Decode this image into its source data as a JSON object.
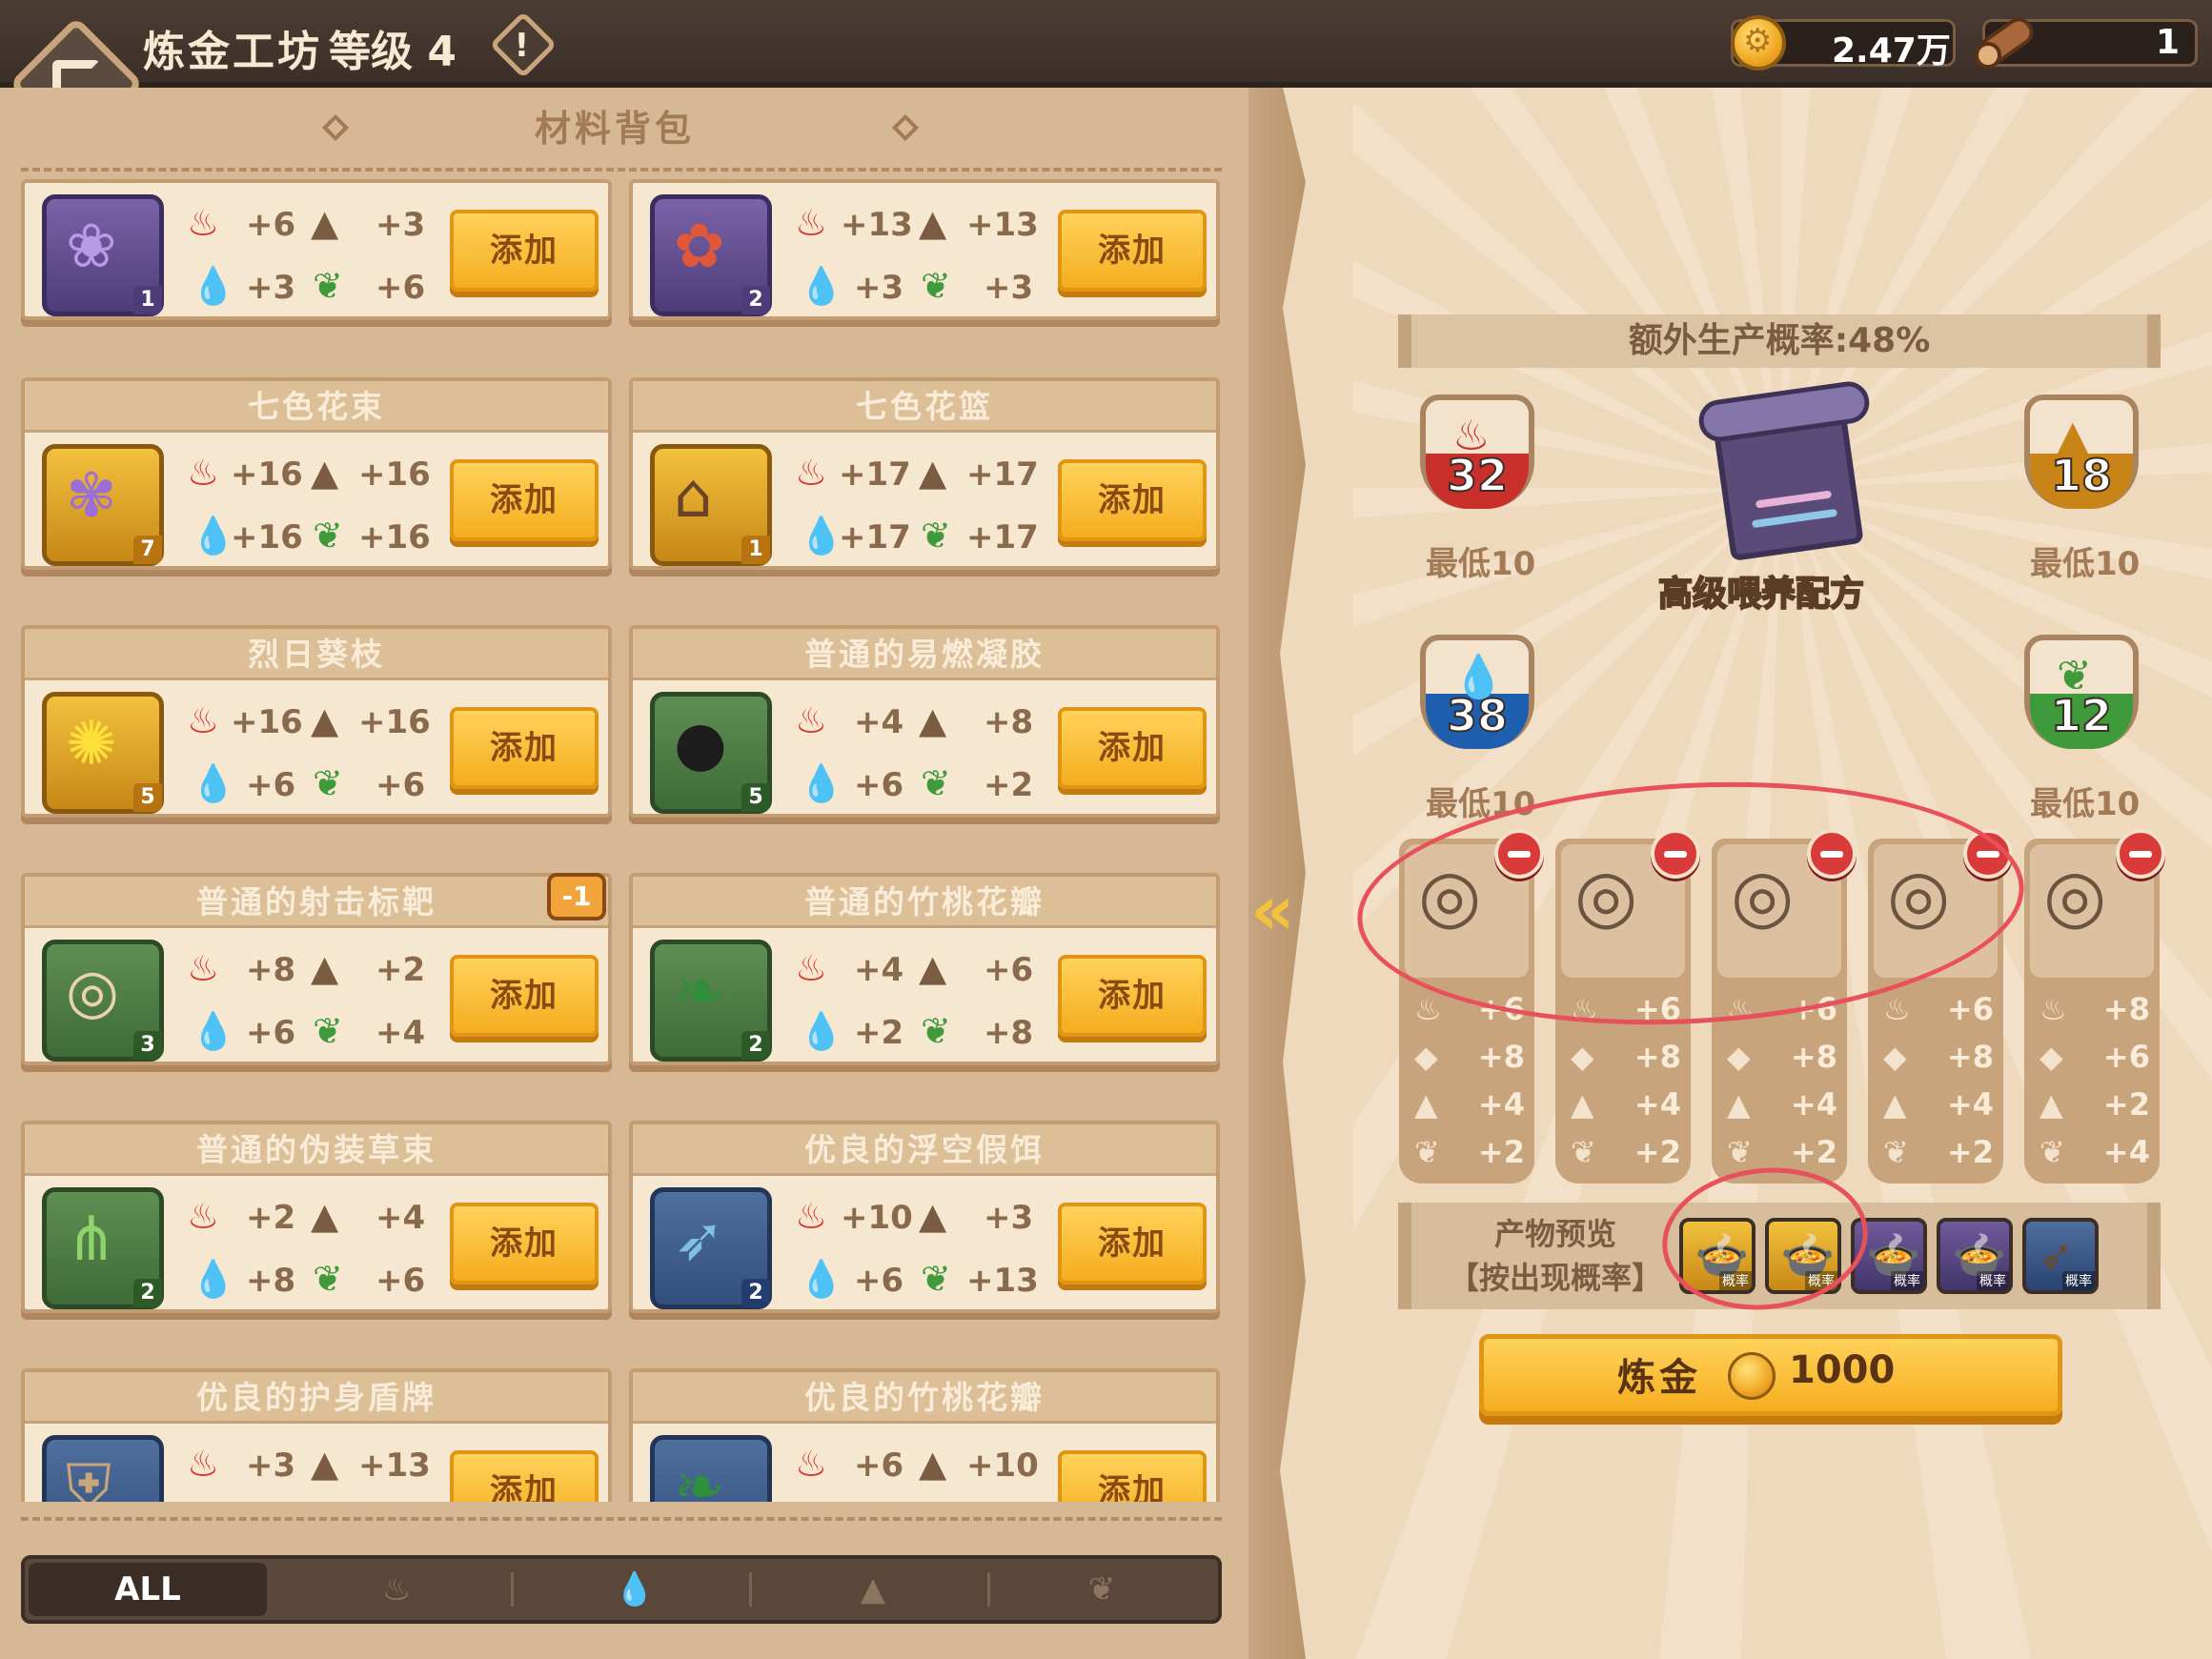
{
  "header": {
    "title": "炼金工坊",
    "level_text": "等级 4",
    "warning": "!",
    "coins": "2.47万",
    "wood": "1"
  },
  "bag": {
    "title": "材料背包",
    "add_label": "添加",
    "items": [
      {
        "name": "",
        "qty": "1",
        "fire": "+6",
        "earth": "+3",
        "water": "+3",
        "leaf": "+6",
        "icon": "violet-wreath-icon"
      },
      {
        "name": "",
        "qty": "2",
        "fire": "+13",
        "earth": "+13",
        "water": "+3",
        "leaf": "+3",
        "icon": "red-flower-icon"
      },
      {
        "name": "七色花束",
        "qty": "7",
        "fire": "+16",
        "earth": "+16",
        "water": "+16",
        "leaf": "+16",
        "icon": "bouquet-icon"
      },
      {
        "name": "七色花篮",
        "qty": "1",
        "fire": "+17",
        "earth": "+17",
        "water": "+17",
        "leaf": "+17",
        "icon": "flower-basket-icon"
      },
      {
        "name": "烈日葵枝",
        "qty": "5",
        "fire": "+16",
        "earth": "+16",
        "water": "+6",
        "leaf": "+6",
        "icon": "sunflower-icon"
      },
      {
        "name": "普通的易燃凝胶",
        "qty": "5",
        "fire": "+4",
        "earth": "+8",
        "water": "+6",
        "leaf": "+2",
        "icon": "gel-icon"
      },
      {
        "name": "普通的射击标靶",
        "qty": "3",
        "fire": "+8",
        "earth": "+2",
        "water": "+6",
        "leaf": "+4",
        "icon": "target-icon",
        "minus": "-1"
      },
      {
        "name": "普通的竹桃花瓣",
        "qty": "2",
        "fire": "+4",
        "earth": "+6",
        "water": "+2",
        "leaf": "+8",
        "icon": "leaf-petal-icon"
      },
      {
        "name": "普通的伪装草束",
        "qty": "2",
        "fire": "+2",
        "earth": "+4",
        "water": "+8",
        "leaf": "+6",
        "icon": "grass-bundle-icon"
      },
      {
        "name": "优良的浮空假饵",
        "qty": "2",
        "fire": "+10",
        "earth": "+3",
        "water": "+6",
        "leaf": "+13",
        "icon": "fish-lure-icon"
      },
      {
        "name": "优良的护身盾牌",
        "qty": "",
        "fire": "+3",
        "earth": "+13",
        "water": "",
        "leaf": "",
        "icon": "shield-icon"
      },
      {
        "name": "优良的竹桃花瓣",
        "qty": "",
        "fire": "+6",
        "earth": "+10",
        "water": "",
        "leaf": "",
        "icon": "leaf-petal-icon"
      }
    ]
  },
  "filter": {
    "all": "ALL"
  },
  "alchemy": {
    "extra_rate": "额外生产概率:48%",
    "recipe_name": "高级喂养配方",
    "fire": {
      "value": "32",
      "min": "最低10"
    },
    "earth": {
      "value": "18",
      "min": "最低10"
    },
    "water": {
      "value": "38",
      "min": "最低10"
    },
    "leaf": {
      "value": "12",
      "min": "最低10"
    },
    "slots": [
      {
        "a": "+6",
        "b": "+8",
        "c": "+4",
        "d": "+2"
      },
      {
        "a": "+6",
        "b": "+8",
        "c": "+4",
        "d": "+2"
      },
      {
        "a": "+6",
        "b": "+8",
        "c": "+4",
        "d": "+2"
      },
      {
        "a": "+6",
        "b": "+8",
        "c": "+4",
        "d": "+2"
      },
      {
        "a": "+8",
        "b": "+6",
        "c": "+2",
        "d": "+4"
      }
    ],
    "preview_line1": "产物预览",
    "preview_line2": "【按出现概率】",
    "preview_tag": "概率",
    "button_label": "炼金",
    "button_cost": "1000"
  },
  "colors": {
    "accent": "#f5ad1f",
    "fire": "#d9362b",
    "water": "#2f73c9",
    "earth": "#7a5c43",
    "leaf": "#3f9a3c",
    "annotation": "#e8505b"
  }
}
